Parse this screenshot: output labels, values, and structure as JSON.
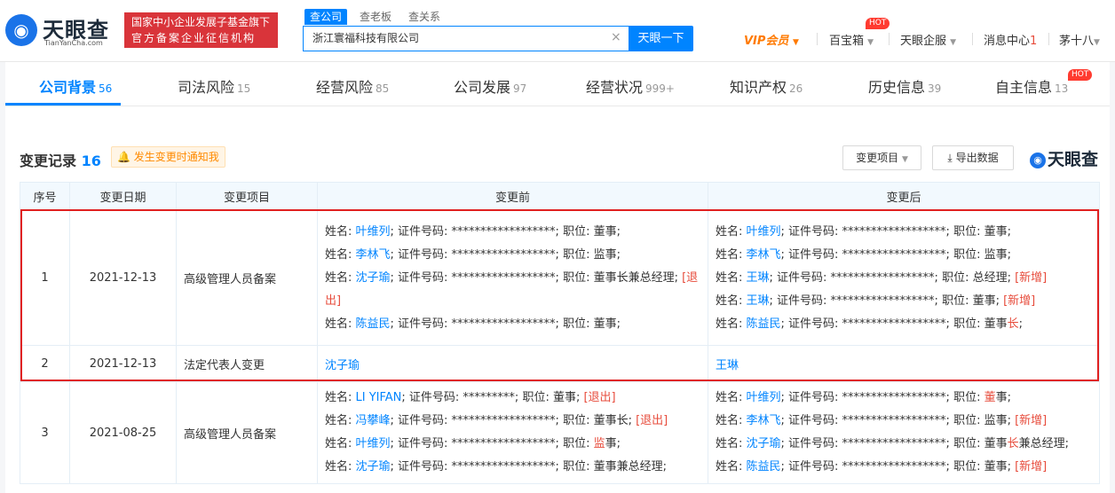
{
  "header": {
    "logo_text": "天眼查",
    "logo_sub": "TianYanCha.com",
    "banner_line1": "国家中小企业发展子基金旗下",
    "banner_line2": "官方备案企业征信机构",
    "search_tabs": [
      "查公司",
      "查老板",
      "查关系"
    ],
    "search_value": "浙江寰福科技有限公司",
    "search_button": "天眼一下",
    "nav": {
      "vip": "VIP会员",
      "box": "百宝箱",
      "hot": "HOT",
      "enterprise": "天眼企服",
      "messages": "消息中心",
      "message_count": "1",
      "user": "茅十八"
    }
  },
  "tabs": [
    {
      "label": "公司背景",
      "count": "56"
    },
    {
      "label": "司法风险",
      "count": "15"
    },
    {
      "label": "经营风险",
      "count": "85"
    },
    {
      "label": "公司发展",
      "count": "97"
    },
    {
      "label": "经营状况",
      "count": "999+"
    },
    {
      "label": "知识产权",
      "count": "26"
    },
    {
      "label": "历史信息",
      "count": "39"
    },
    {
      "label": "自主信息",
      "count": "13"
    }
  ],
  "tabs_hot": "HOT",
  "section": {
    "title": "变更记录",
    "count": "16",
    "notify": "发生变更时通知我",
    "filter_button": "变更项目",
    "export_button": "导出数据",
    "watermark": "天眼查"
  },
  "table": {
    "headers": [
      "序号",
      "变更日期",
      "变更项目",
      "变更前",
      "变更后"
    ],
    "rows": [
      {
        "no": "1",
        "date": "2021-12-13",
        "item": "高级管理人员备案",
        "before": [
          {
            "p": "姓名: ",
            "n": "叶维列",
            "s": "; 证件号码: ******************; 职位: 董事;",
            "t": ""
          },
          {
            "p": "姓名: ",
            "n": "李林飞",
            "s": "; 证件号码: ******************; 职位: 监事;",
            "t": ""
          },
          {
            "p": "姓名: ",
            "n": "沈子瑜",
            "s": "; 证件号码: ******************; 职位: 董事长兼总经理; ",
            "t": "[退出]"
          },
          {
            "p": "姓名: ",
            "n": "陈益民",
            "s": "; 证件号码: ******************; 职位: 董事;",
            "t": ""
          }
        ],
        "after": [
          {
            "p": "姓名: ",
            "n": "叶维列",
            "s": "; 证件号码: ******************; 职位: 董事;",
            "t": ""
          },
          {
            "p": "姓名: ",
            "n": "李林飞",
            "s": "; 证件号码: ******************; 职位: 监事;",
            "t": ""
          },
          {
            "p": "姓名: ",
            "n": "王琳",
            "s": "; 证件号码: ******************; 职位: 总经理; ",
            "t": "[新增]"
          },
          {
            "p": "姓名: ",
            "n": "王琳",
            "s": "; 证件号码: ******************; 职位: 董事; ",
            "t": "[新增]"
          },
          {
            "p": "姓名: ",
            "n": "陈益民",
            "s": "; 证件号码: ******************; 职位: 董事",
            "t": "长",
            "e": ";"
          }
        ]
      },
      {
        "no": "2",
        "date": "2021-12-13",
        "item": "法定代表人变更",
        "before_name": "沈子瑜",
        "after_name": "王琳"
      },
      {
        "no": "3",
        "date": "2021-08-25",
        "item": "高级管理人员备案",
        "before": [
          {
            "p": "姓名: ",
            "n": "LI YIFAN",
            "s": "; 证件号码: *********; 职位: 董事; ",
            "t": "[退出]"
          },
          {
            "p": "姓名: ",
            "n": "冯攀峰",
            "s": "; 证件号码: ******************; 职位: 董事长; ",
            "t": "[退出]"
          },
          {
            "p": "姓名: ",
            "n": "叶维列",
            "s": "; 证件号码: ******************; 职位: ",
            "t": "监",
            "e": "事;"
          },
          {
            "p": "姓名: ",
            "n": "沈子瑜",
            "s": "; 证件号码: ******************; 职位: 董事兼总经理;",
            "t": ""
          }
        ],
        "after": [
          {
            "p": "姓名: ",
            "n": "叶维列",
            "s": "; 证件号码: ******************; 职位: ",
            "t": "董",
            "e": "事;"
          },
          {
            "p": "姓名: ",
            "n": "李林飞",
            "s": "; 证件号码: ******************; 职位: 监事; ",
            "t": "[新增]"
          },
          {
            "p": "姓名: ",
            "n": "沈子瑜",
            "s": "; 证件号码: ******************; 职位: 董事",
            "t": "长",
            "e": "兼总经理;"
          },
          {
            "p": "姓名: ",
            "n": "陈益民",
            "s": "; 证件号码: ******************; 职位: 董事; ",
            "t": "[新增]"
          }
        ]
      }
    ]
  }
}
